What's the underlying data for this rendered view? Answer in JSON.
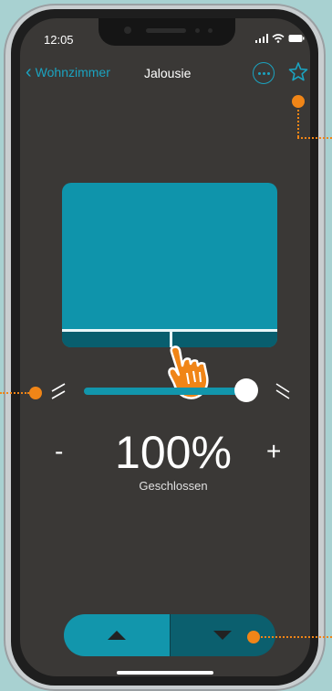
{
  "status": {
    "time": "12:05"
  },
  "nav": {
    "back_label": "Wohnzimmer",
    "title": "Jalousie"
  },
  "position": {
    "value": "100%",
    "state_label": "Geschlossen",
    "level_fraction": 1.0
  },
  "controls": {
    "minus_label": "-",
    "plus_label": "+"
  },
  "icons": {
    "back": "chevron-left-icon",
    "more": "more-options-icon",
    "favorite": "star-icon",
    "tilt_open": "tilt-open-icon",
    "tilt_closed": "tilt-closed-icon",
    "up": "arrow-up-icon",
    "down": "arrow-down-icon",
    "hand": "tap-hand-icon"
  },
  "colors": {
    "accent": "#1ba3c0",
    "blind": "#0f94ab",
    "blind_dark": "#085e6e",
    "background": "#3a3836",
    "highlight": "#f08517"
  }
}
